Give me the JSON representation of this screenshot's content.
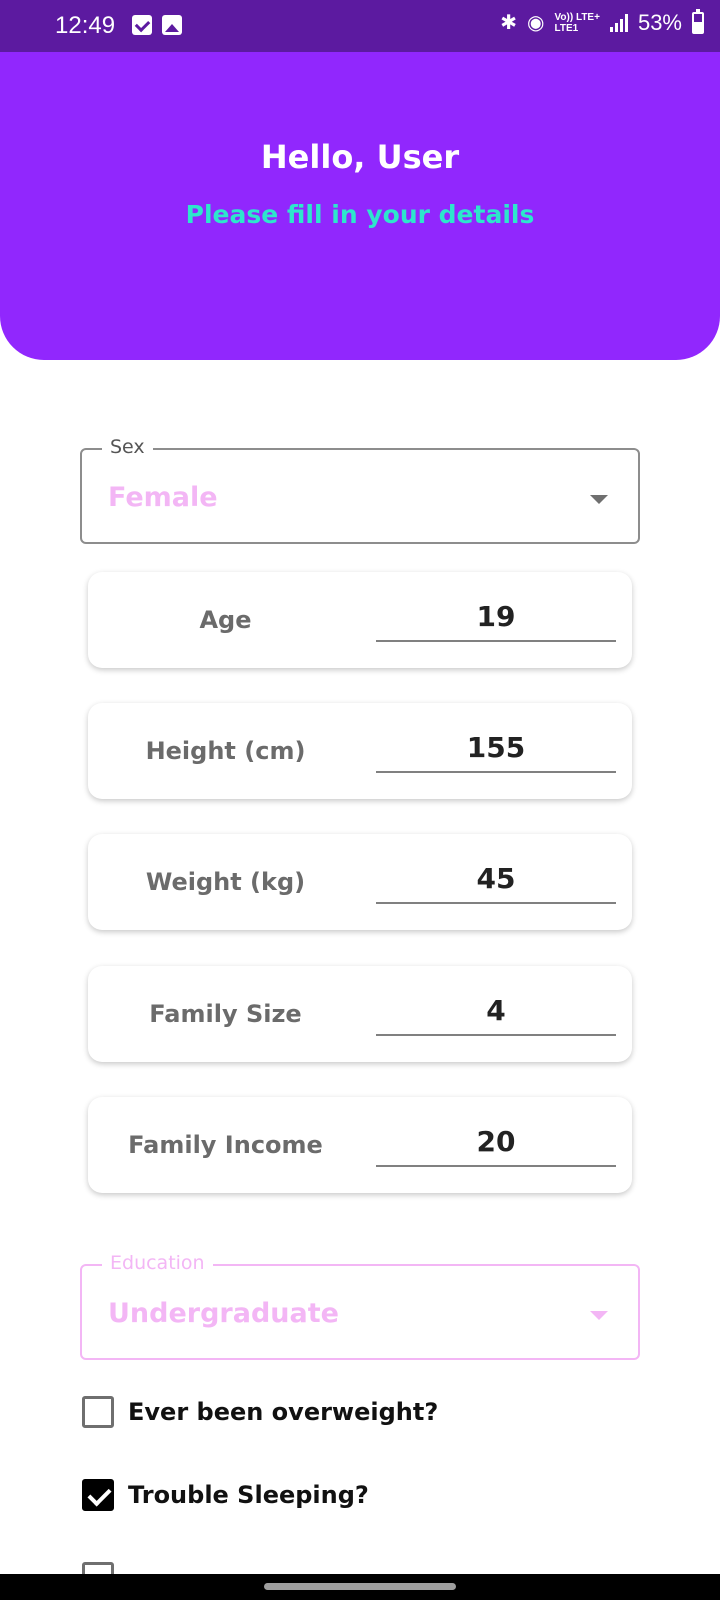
{
  "status_bar": {
    "time": "12:49",
    "network_top": "Vo)) LTE+",
    "network_bottom": "LTE1",
    "battery": "53%",
    "battery_level": 0.53,
    "icons": [
      "checkbox-notification-icon",
      "image-notification-icon",
      "bluetooth-icon",
      "hotspot-icon",
      "signal-icon",
      "battery-icon"
    ]
  },
  "header": {
    "greeting": "Hello, User",
    "subtitle": "Please fill in your details",
    "colors": {
      "background": "#9127fd",
      "subtitle": "#2de6cc"
    }
  },
  "sex_field": {
    "label": "Sex",
    "value": "Female"
  },
  "fields": [
    {
      "label": "Age",
      "value": "19"
    },
    {
      "label": "Height (cm)",
      "value": "155"
    },
    {
      "label": "Weight (kg)",
      "value": "45"
    },
    {
      "label": "Family Size",
      "value": "4"
    },
    {
      "label": "Family Income",
      "value": "20"
    }
  ],
  "education_field": {
    "label": "Education",
    "value": "Undergraduate"
  },
  "checkboxes": [
    {
      "label": "Ever been overweight?",
      "checked": false
    },
    {
      "label": "Trouble Sleeping?",
      "checked": true
    }
  ]
}
